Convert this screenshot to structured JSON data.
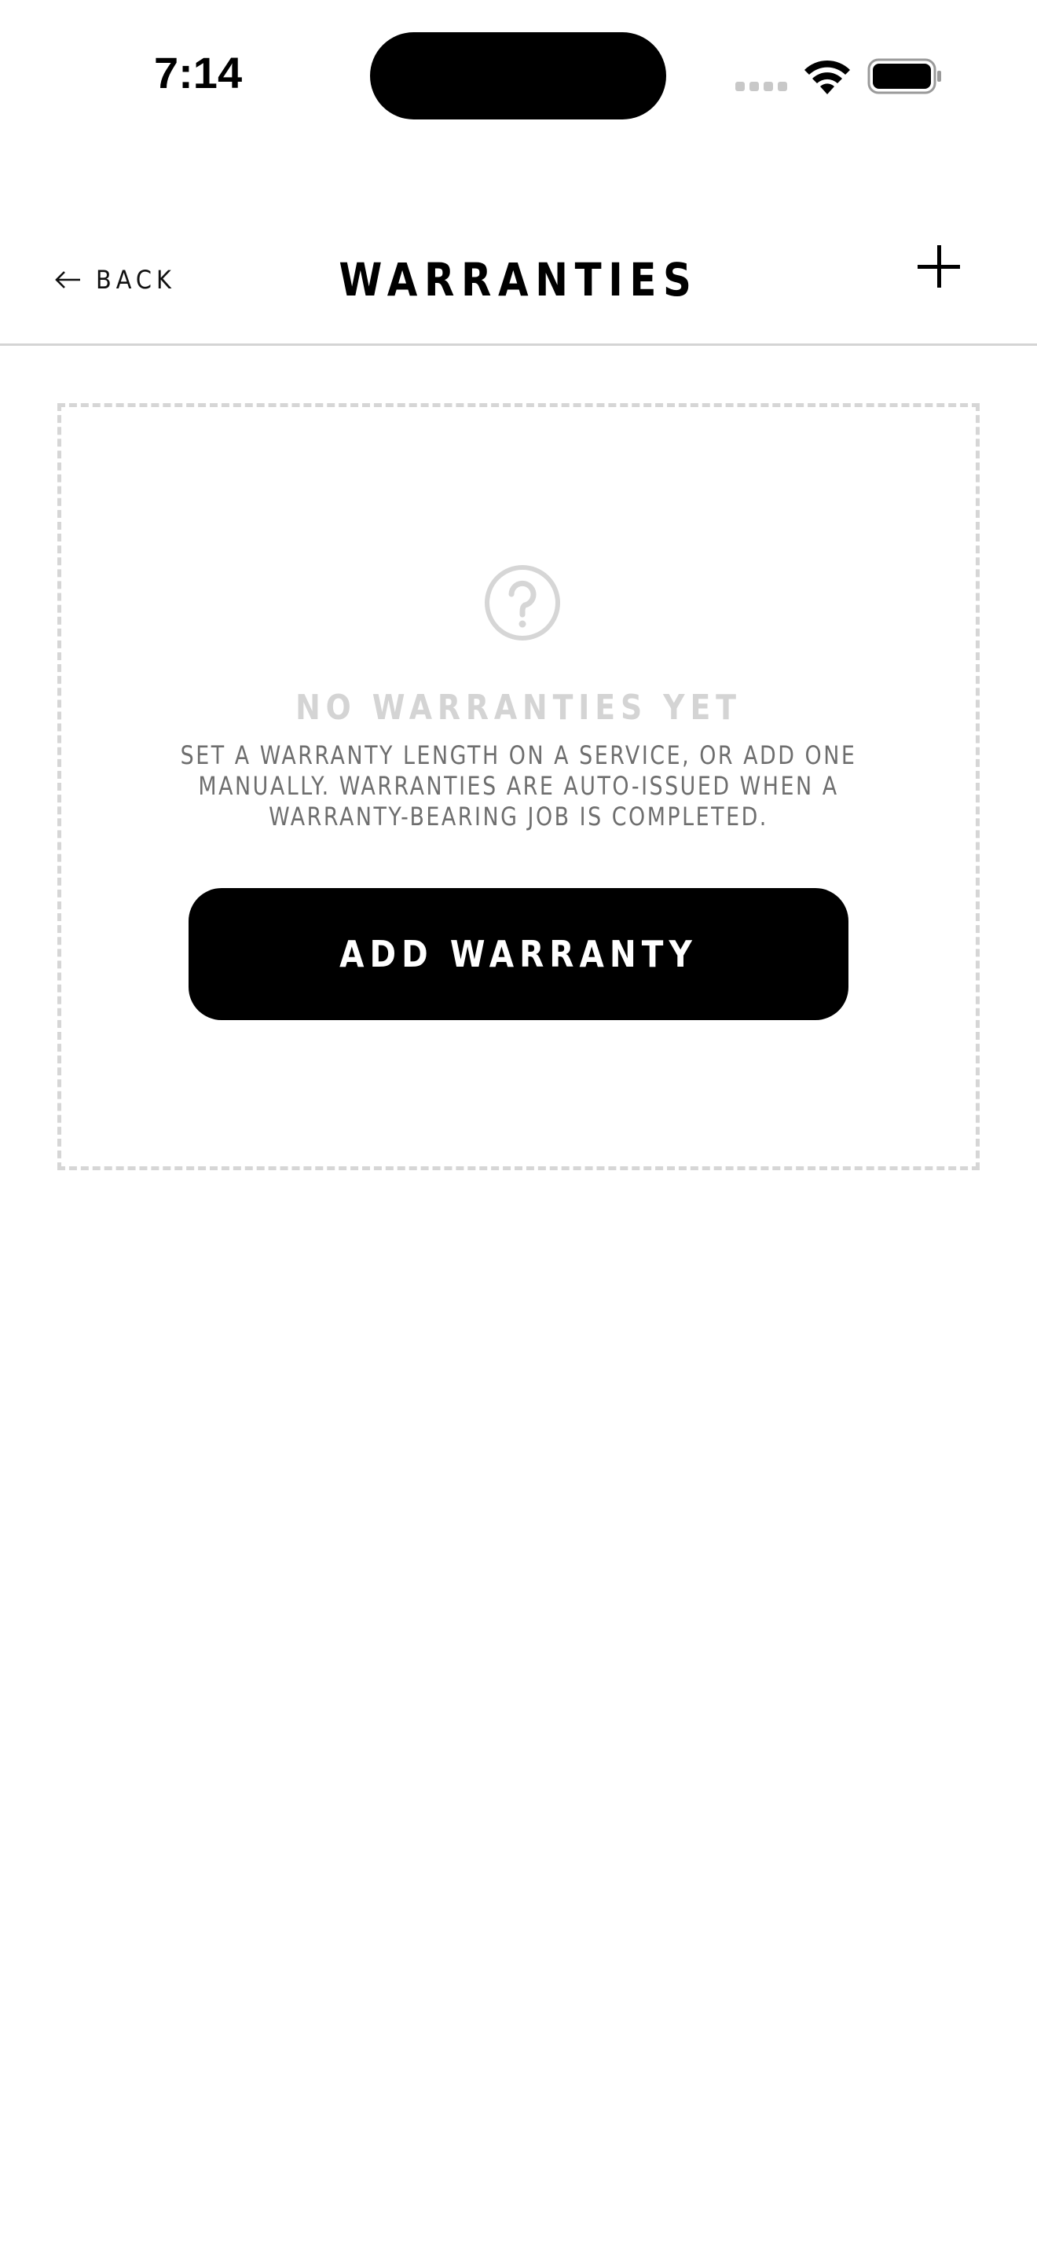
{
  "status_bar": {
    "time": "7:14",
    "signal_icon": "cellular-signal-icon",
    "wifi_icon": "wifi-icon",
    "battery_icon": "battery-icon"
  },
  "header": {
    "back_icon": "left-arrow-icon",
    "back_label": "BACK",
    "title": "WARRANTIES",
    "add_icon": "plus-icon"
  },
  "empty_state": {
    "icon": "question-circle-icon",
    "title": "NO WARRANTIES YET",
    "description": "SET A WARRANTY LENGTH ON A SERVICE, OR ADD ONE MANUALLY. WARRANTIES ARE AUTO-ISSUED WHEN A WARRANTY-BEARING JOB IS COMPLETED.",
    "button_label": "ADD WARRANTY"
  },
  "colors": {
    "background": "#ffffff",
    "primary": "#000000",
    "muted_text": "#6e6e6e",
    "placeholder": "#d4d4d4",
    "divider": "#d4d4d4"
  }
}
